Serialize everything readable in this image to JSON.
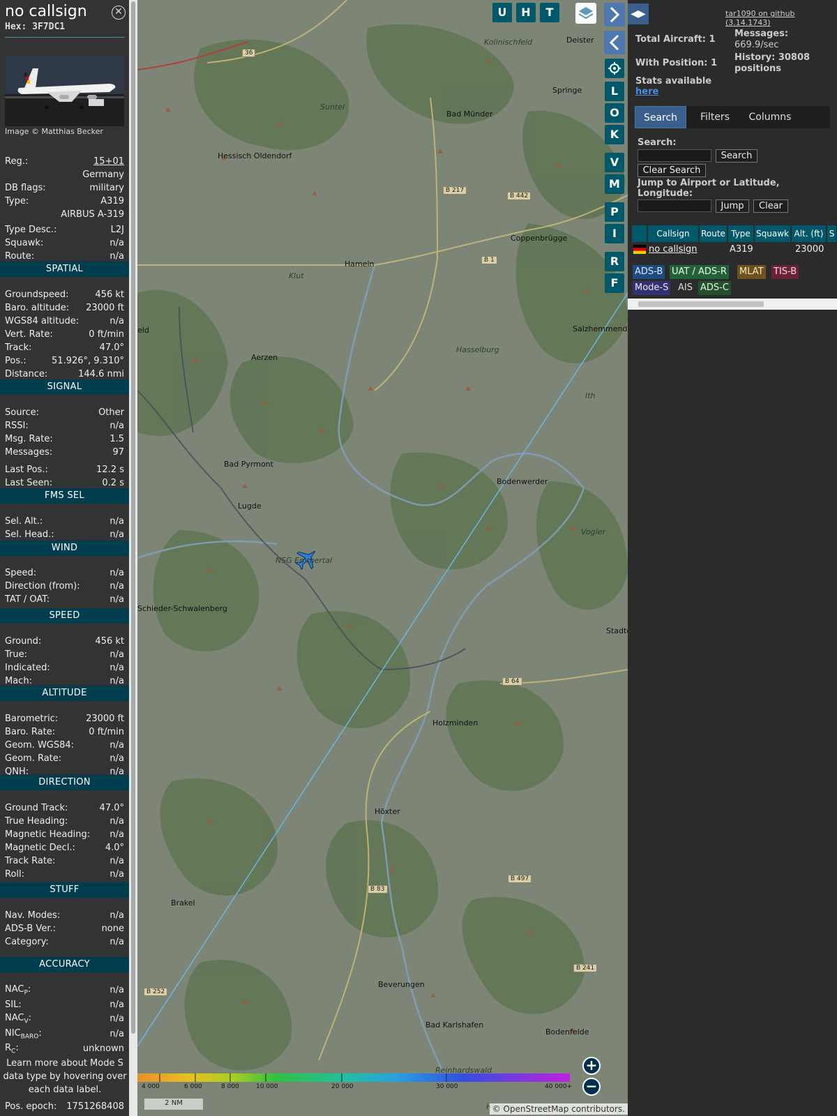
{
  "info": {
    "title": "no callsign",
    "hex": "Hex: 3F7DC1",
    "credit": "Image © Matthias Becker",
    "general": [
      {
        "label": "Reg.:",
        "value": "15+01"
      },
      {
        "label": "",
        "value": "Germany"
      },
      {
        "label": "DB flags:",
        "value": "military"
      },
      {
        "label": "Type:",
        "value": "A319"
      },
      {
        "label": "",
        "value": "AIRBUS A-319"
      },
      {
        "label": "Type Desc.:",
        "value": "L2J"
      },
      {
        "label": "Squawk:",
        "value": "n/a"
      },
      {
        "label": "Route:",
        "value": "n/a"
      }
    ],
    "sections": [
      {
        "title": "SPATIAL",
        "rows": [
          {
            "label": "Groundspeed:",
            "value": "456 kt"
          },
          {
            "label": "Baro. altitude:",
            "value": "23000 ft"
          },
          {
            "label": "WGS84 altitude:",
            "value": "n/a"
          },
          {
            "label": "Vert. Rate:",
            "value": "0 ft/min"
          },
          {
            "label": "Track:",
            "value": "47.0°"
          },
          {
            "label": "Pos.:",
            "value": "51.926°, 9.310°"
          },
          {
            "label": "Distance:",
            "value": "144.6 nmi"
          }
        ]
      },
      {
        "title": "SIGNAL",
        "rows": [
          {
            "label": "Source:",
            "value": "Other"
          },
          {
            "label": "RSSI:",
            "value": "n/a"
          },
          {
            "label": "Msg. Rate:",
            "value": "1.5"
          },
          {
            "label": "Messages:",
            "value": "97"
          },
          {
            "label": "Last Pos.:",
            "value": "12.2 s"
          },
          {
            "label": "Last Seen:",
            "value": "0.2 s"
          }
        ]
      },
      {
        "title": "FMS SEL",
        "rows": [
          {
            "label": "Sel. Alt.:",
            "value": "n/a"
          },
          {
            "label": "Sel. Head.:",
            "value": "n/a"
          }
        ]
      },
      {
        "title": "WIND",
        "rows": [
          {
            "label": "Speed:",
            "value": "n/a"
          },
          {
            "label": "Direction (from):",
            "value": "n/a"
          },
          {
            "label": "TAT / OAT:",
            "value": "n/a"
          }
        ]
      },
      {
        "title": "SPEED",
        "rows": [
          {
            "label": "Ground:",
            "value": "456 kt"
          },
          {
            "label": "True:",
            "value": "n/a"
          },
          {
            "label": "Indicated:",
            "value": "n/a"
          },
          {
            "label": "Mach:",
            "value": "n/a"
          }
        ]
      },
      {
        "title": "ALTITUDE",
        "rows": [
          {
            "label": "Barometric:",
            "value": "23000 ft"
          },
          {
            "label": "Baro. Rate:",
            "value": "0 ft/min"
          },
          {
            "label": "Geom. WGS84:",
            "value": "n/a"
          },
          {
            "label": "Geom. Rate:",
            "value": "n/a"
          },
          {
            "label": "QNH:",
            "value": "n/a"
          }
        ]
      },
      {
        "title": "DIRECTION",
        "rows": [
          {
            "label": "Ground Track:",
            "value": "47.0°"
          },
          {
            "label": "True Heading:",
            "value": "n/a"
          },
          {
            "label": "Magnetic Heading:",
            "value": "n/a"
          },
          {
            "label": "Magnetic Decl.:",
            "value": "4.0°"
          },
          {
            "label": "Track Rate:",
            "value": "n/a"
          },
          {
            "label": "Roll:",
            "value": "n/a"
          }
        ]
      },
      {
        "title": "STUFF",
        "rows": [
          {
            "label": "Nav. Modes:",
            "value": "n/a"
          },
          {
            "label": "ADS-B Ver.:",
            "value": "none"
          },
          {
            "label": "Category:",
            "value": "n/a"
          }
        ]
      },
      {
        "title": "ACCURACY",
        "rows": [
          {
            "label": "NAC",
            "sub": "P",
            "value": "n/a"
          },
          {
            "label": "SIL:",
            "value": "n/a"
          },
          {
            "label": "NAC",
            "sub": "V",
            "value": "n/a"
          },
          {
            "label": "NIC",
            "sub": "BARO",
            "value": "n/a"
          },
          {
            "label": "R",
            "sub": "C",
            "value": "unknown"
          }
        ]
      }
    ],
    "learn": "Learn more about Mode S data type by hovering over each data label.",
    "epoch_label": "Pos. epoch:",
    "epoch_value": "1751268408"
  },
  "map": {
    "buttons": [
      "U",
      "H",
      "T"
    ],
    "side_buttons": [
      "L",
      "O",
      "K",
      "V",
      "M",
      "P",
      "I",
      "R",
      "F"
    ],
    "places": [
      {
        "name": "Suntel"
      },
      {
        "name": "Bad Münder"
      },
      {
        "name": "Springe"
      },
      {
        "name": "Deister"
      },
      {
        "name": "Hessisch Oldendorf"
      },
      {
        "name": "Coppenbrügge"
      },
      {
        "name": "Hameln"
      },
      {
        "name": "Klut"
      },
      {
        "name": "Salzhemmendorf"
      },
      {
        "name": "Hasselburg"
      },
      {
        "name": "Aerzen"
      },
      {
        "name": "Ith"
      },
      {
        "name": "Bad Pyrmont"
      },
      {
        "name": "Bodenwerder"
      },
      {
        "name": "Lugde"
      },
      {
        "name": "Vogler"
      },
      {
        "name": "NSG Emmertal"
      },
      {
        "name": "Schieder-Schwalenberg"
      },
      {
        "name": "Stadto"
      },
      {
        "name": "Holzminden"
      },
      {
        "name": "Höxter"
      },
      {
        "name": "Brakel"
      },
      {
        "name": "Beverungen"
      },
      {
        "name": "Bad Karlshafen"
      },
      {
        "name": "Bodenfelde"
      },
      {
        "name": "Reinhardswald"
      },
      {
        "name": "Hessen"
      },
      {
        "name": "Kollnischfeld"
      },
      {
        "name": "eld"
      }
    ],
    "roads": [
      "B 217",
      "B 442",
      "B 1",
      "B 64",
      "B 497",
      "B 83",
      "B 241",
      "B 252",
      "36"
    ],
    "legend": [
      "4 000",
      "6 000",
      "8 000",
      "10 000",
      "20 000",
      "30 000",
      "40 000+"
    ],
    "scale": "2 NM",
    "attribution": "© OpenStreetMap contributors."
  },
  "sidebar": {
    "github": "tar1090 on github (3.14.1743)",
    "total_aircraft": "Total Aircraft: 1",
    "with_position": "With Position: 1",
    "messages_label": "Messages:",
    "messages_value": "669.9/sec",
    "history_label": "History: 30808",
    "history_value": "positions",
    "stats_label": "Stats available",
    "stats_link": "here",
    "tabs": [
      "Search",
      "Filters",
      "Columns"
    ],
    "search_label": "Search:",
    "search_button": "Search",
    "clear_search": "Clear Search",
    "jump_label": "Jump to Airport or Latitude, Longitude:",
    "jump_button": "Jump",
    "clear_button": "Clear",
    "columns": [
      "Callsign",
      "Route",
      "Type",
      "Squawk",
      "Alt. (ft)",
      "S"
    ],
    "row": {
      "callsign": "no callsign",
      "route": "",
      "type": "A319",
      "squawk": "",
      "alt": "23000"
    },
    "badges": [
      {
        "label": "ADS-B",
        "color": "#1e4a82",
        "text": "#dfe8ff"
      },
      {
        "label": "UAT / ADS-R",
        "color": "#24603b",
        "text": "#e6ffe6"
      },
      {
        "label": "MLAT",
        "color": "#6b5220",
        "text": "#ffe7b0"
      },
      {
        "label": "TIS-B",
        "color": "#6a2238",
        "text": "#ffd6df"
      },
      {
        "label": "Mode-S",
        "color": "#35306e",
        "text": "#e8e4ff"
      },
      {
        "label": "AIS",
        "color": "#2b2b2b",
        "text": "#dddddd"
      },
      {
        "label": "ADS-C",
        "color": "#244f2f",
        "text": "#dff5df"
      }
    ]
  }
}
